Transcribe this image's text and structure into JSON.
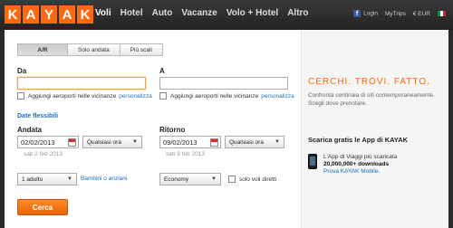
{
  "logo_letters": [
    "K",
    "A",
    "Y",
    "A",
    "K"
  ],
  "nav": [
    "Voli",
    "Hotel",
    "Auto",
    "Vacanze",
    "Volo + Hotel",
    "Altro"
  ],
  "top_right": {
    "login": "Login",
    "mytrips": "MyTrips",
    "currency": "€ EUR"
  },
  "trip_tabs": [
    "A/R",
    "Solo andata",
    "Più scali"
  ],
  "from_label": "Da",
  "to_label": "A",
  "nearby_label": "Aggiungi aeroporti nelle vicinanze",
  "customize": "personalizza",
  "flex_dates": "Date flessibili",
  "depart": {
    "label": "Andata",
    "date": "02/02/2013",
    "time": "Qualsiasi ora",
    "sub": "sab 2 feb 2013"
  },
  "return": {
    "label": "Ritorno",
    "date": "09/02/2013",
    "time": "Qualsiasi ora",
    "sub": "sab 9 feb 2013"
  },
  "travelers": "1 adulto",
  "kids_link": "Bambini o anziani",
  "cabin": "Economy",
  "direct_label": "solo voli diretti",
  "search_btn": "Cerca",
  "promo": {
    "tagline": "CERCHI. TROVI. FATTO.",
    "desc": "Confronta centinaia di siti contemporaneamente. Scegli dove prenotare.",
    "app_title": "Scarica gratis le App di KAYAK",
    "app_line1": "L'App di Viaggi più scaricata",
    "app_line2": "20,000,000+ downloads",
    "app_line3": "Prova KAYAK Mobile."
  }
}
